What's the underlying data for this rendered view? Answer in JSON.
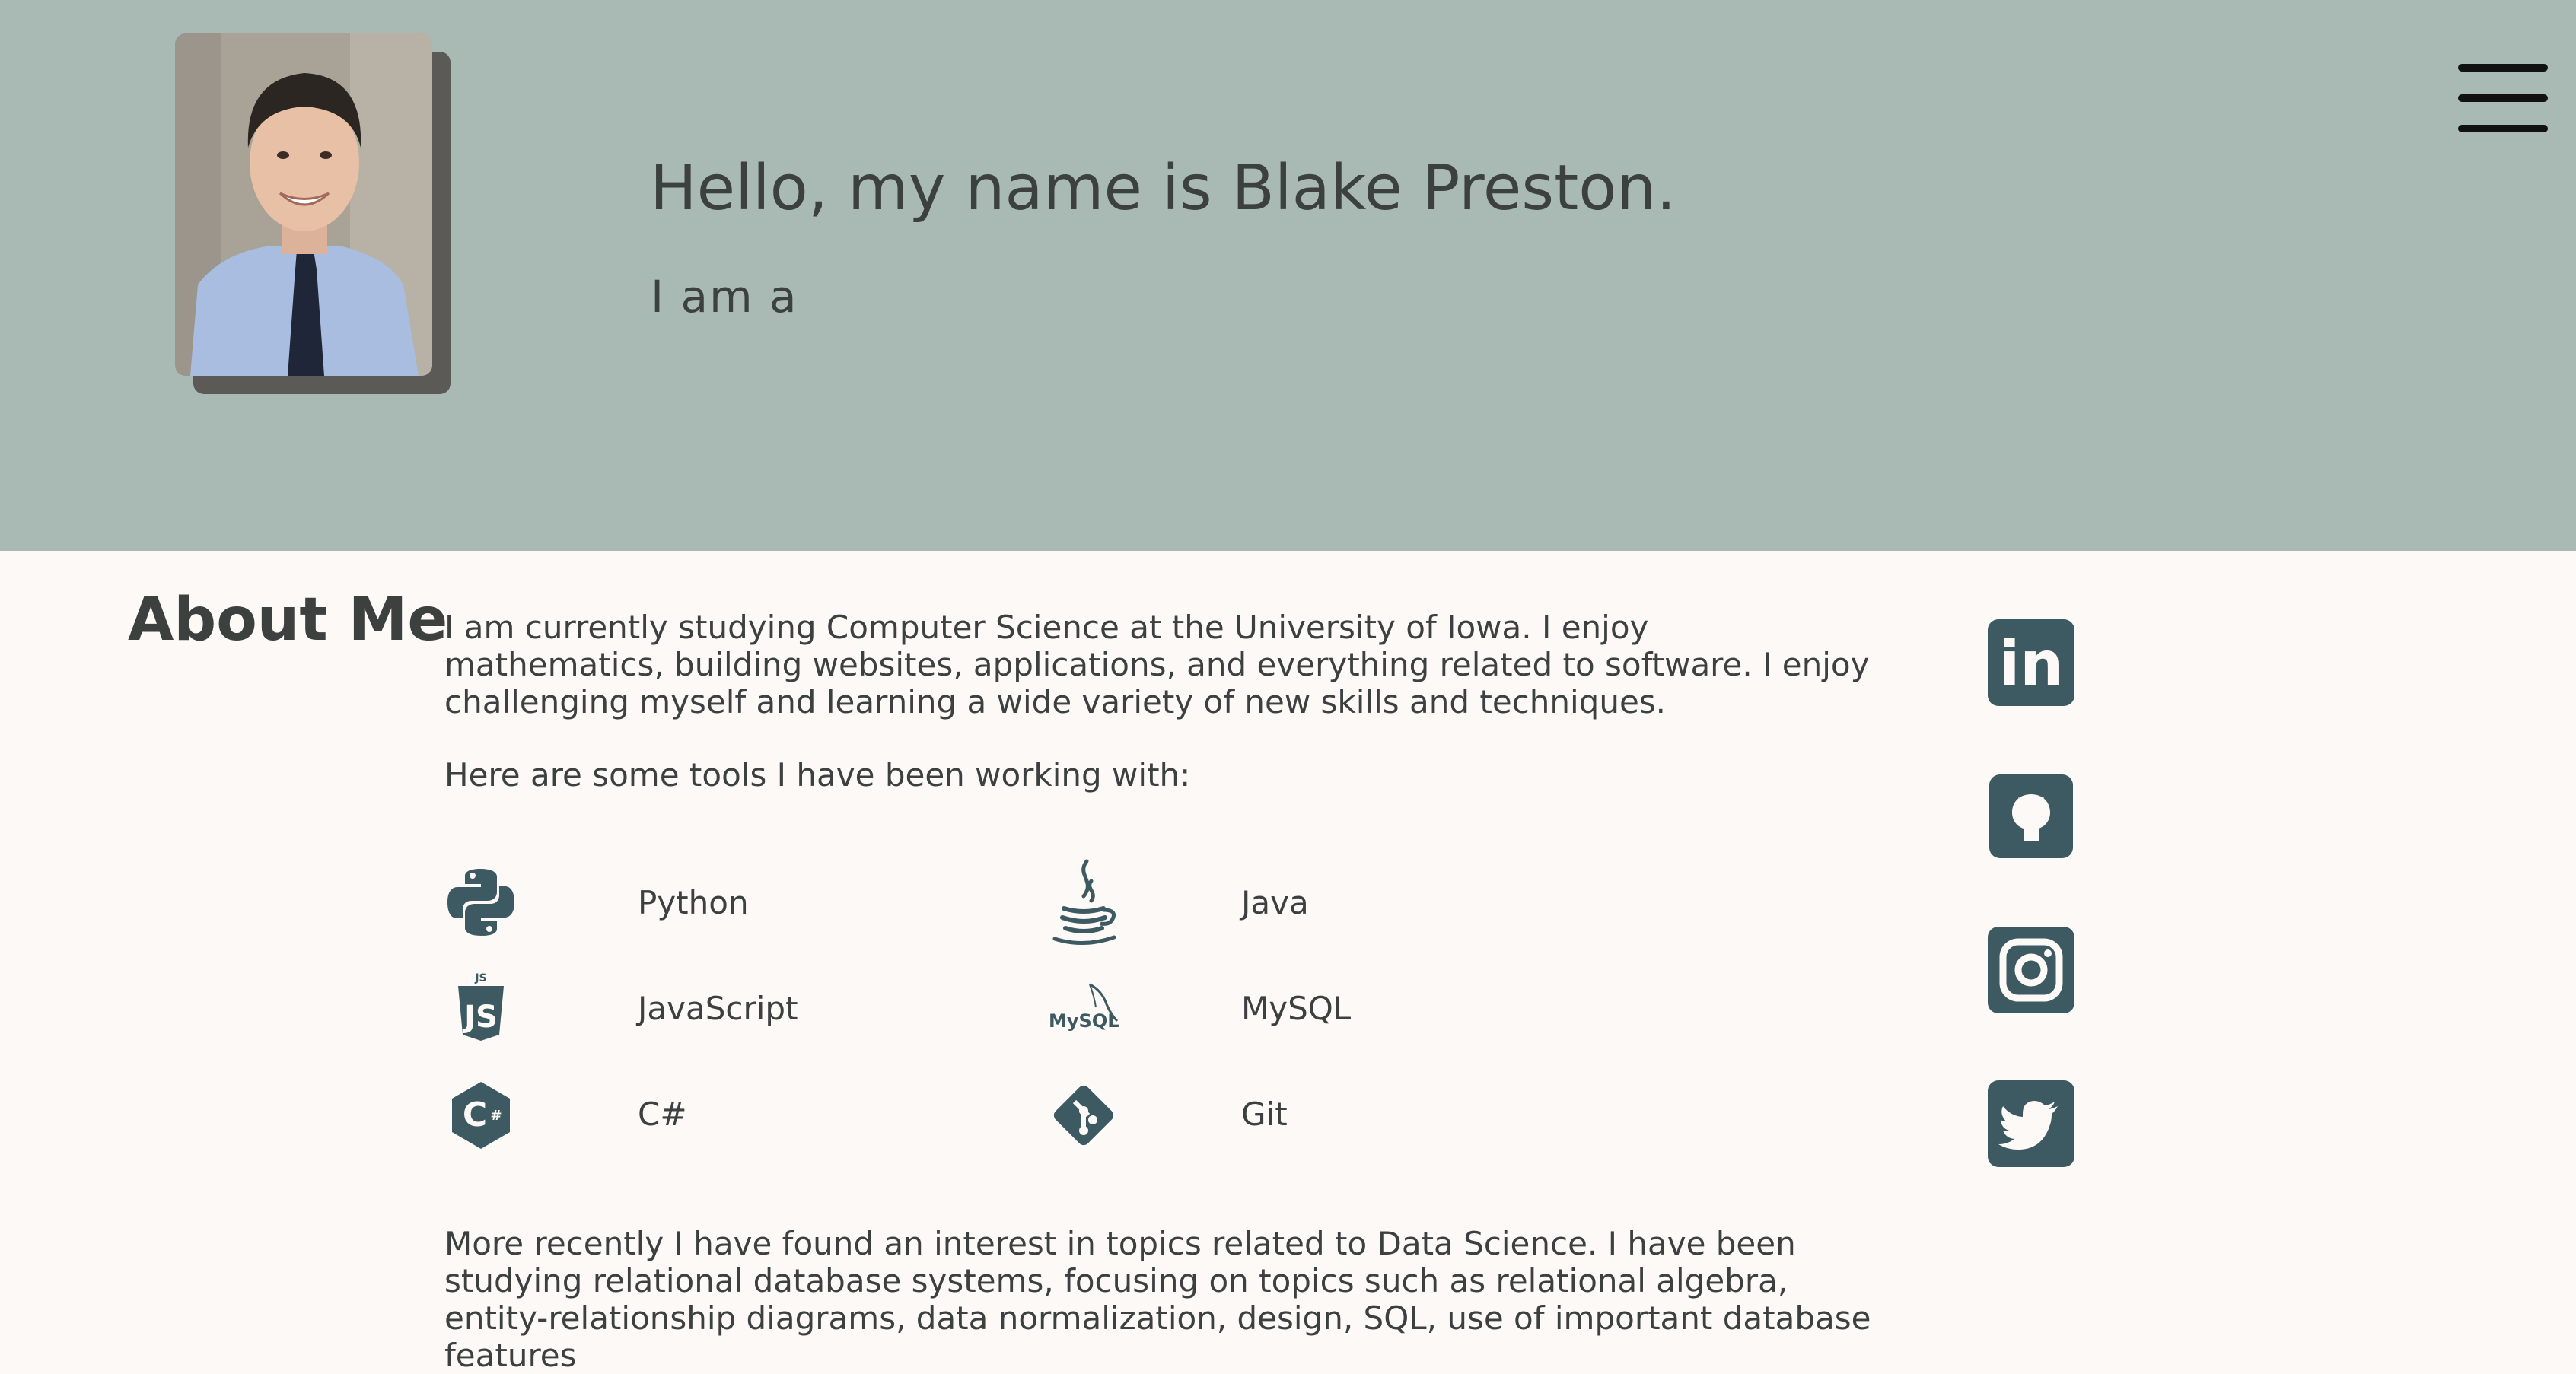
{
  "hero": {
    "greeting": "Hello, my name is Blake Preston.",
    "typed_prefix": "I am a",
    "menu_icon": "hamburger-menu-icon",
    "background_color": "#a9bab4"
  },
  "about": {
    "title": "About Me",
    "intro": "I am currently studying Computer Science at the University of Iowa. I enjoy mathematics, building websites, applications, and everything related to software. I enjoy challenging myself and learning a wide variety of new skills and techniques.",
    "tools_intro": "Here are some tools I have been working with:",
    "tools": [
      {
        "name": "Python",
        "icon": "python-icon"
      },
      {
        "name": "Java",
        "icon": "java-icon"
      },
      {
        "name": "JavaScript",
        "icon": "javascript-icon",
        "icon_text": "JS"
      },
      {
        "name": "MySQL",
        "icon": "mysql-icon",
        "icon_text": "MySQL"
      },
      {
        "name": "C#",
        "icon": "csharp-icon",
        "icon_text": "C#"
      },
      {
        "name": "Git",
        "icon": "git-icon"
      }
    ],
    "data_science": "More recently I have found an interest in topics related to Data Science. I have been studying relational database systems, focusing on topics such as relational algebra, entity-relationship diagrams, data normalization, design, SQL, use of important database features"
  },
  "social": [
    {
      "icon": "linkedin-icon",
      "icon_text": "in"
    },
    {
      "icon": "github-icon"
    },
    {
      "icon": "instagram-icon"
    },
    {
      "icon": "twitter-icon"
    }
  ],
  "colors": {
    "page_background": "#fcf9f6",
    "text": "#3c403e",
    "icon_fill": "#3d5961"
  }
}
